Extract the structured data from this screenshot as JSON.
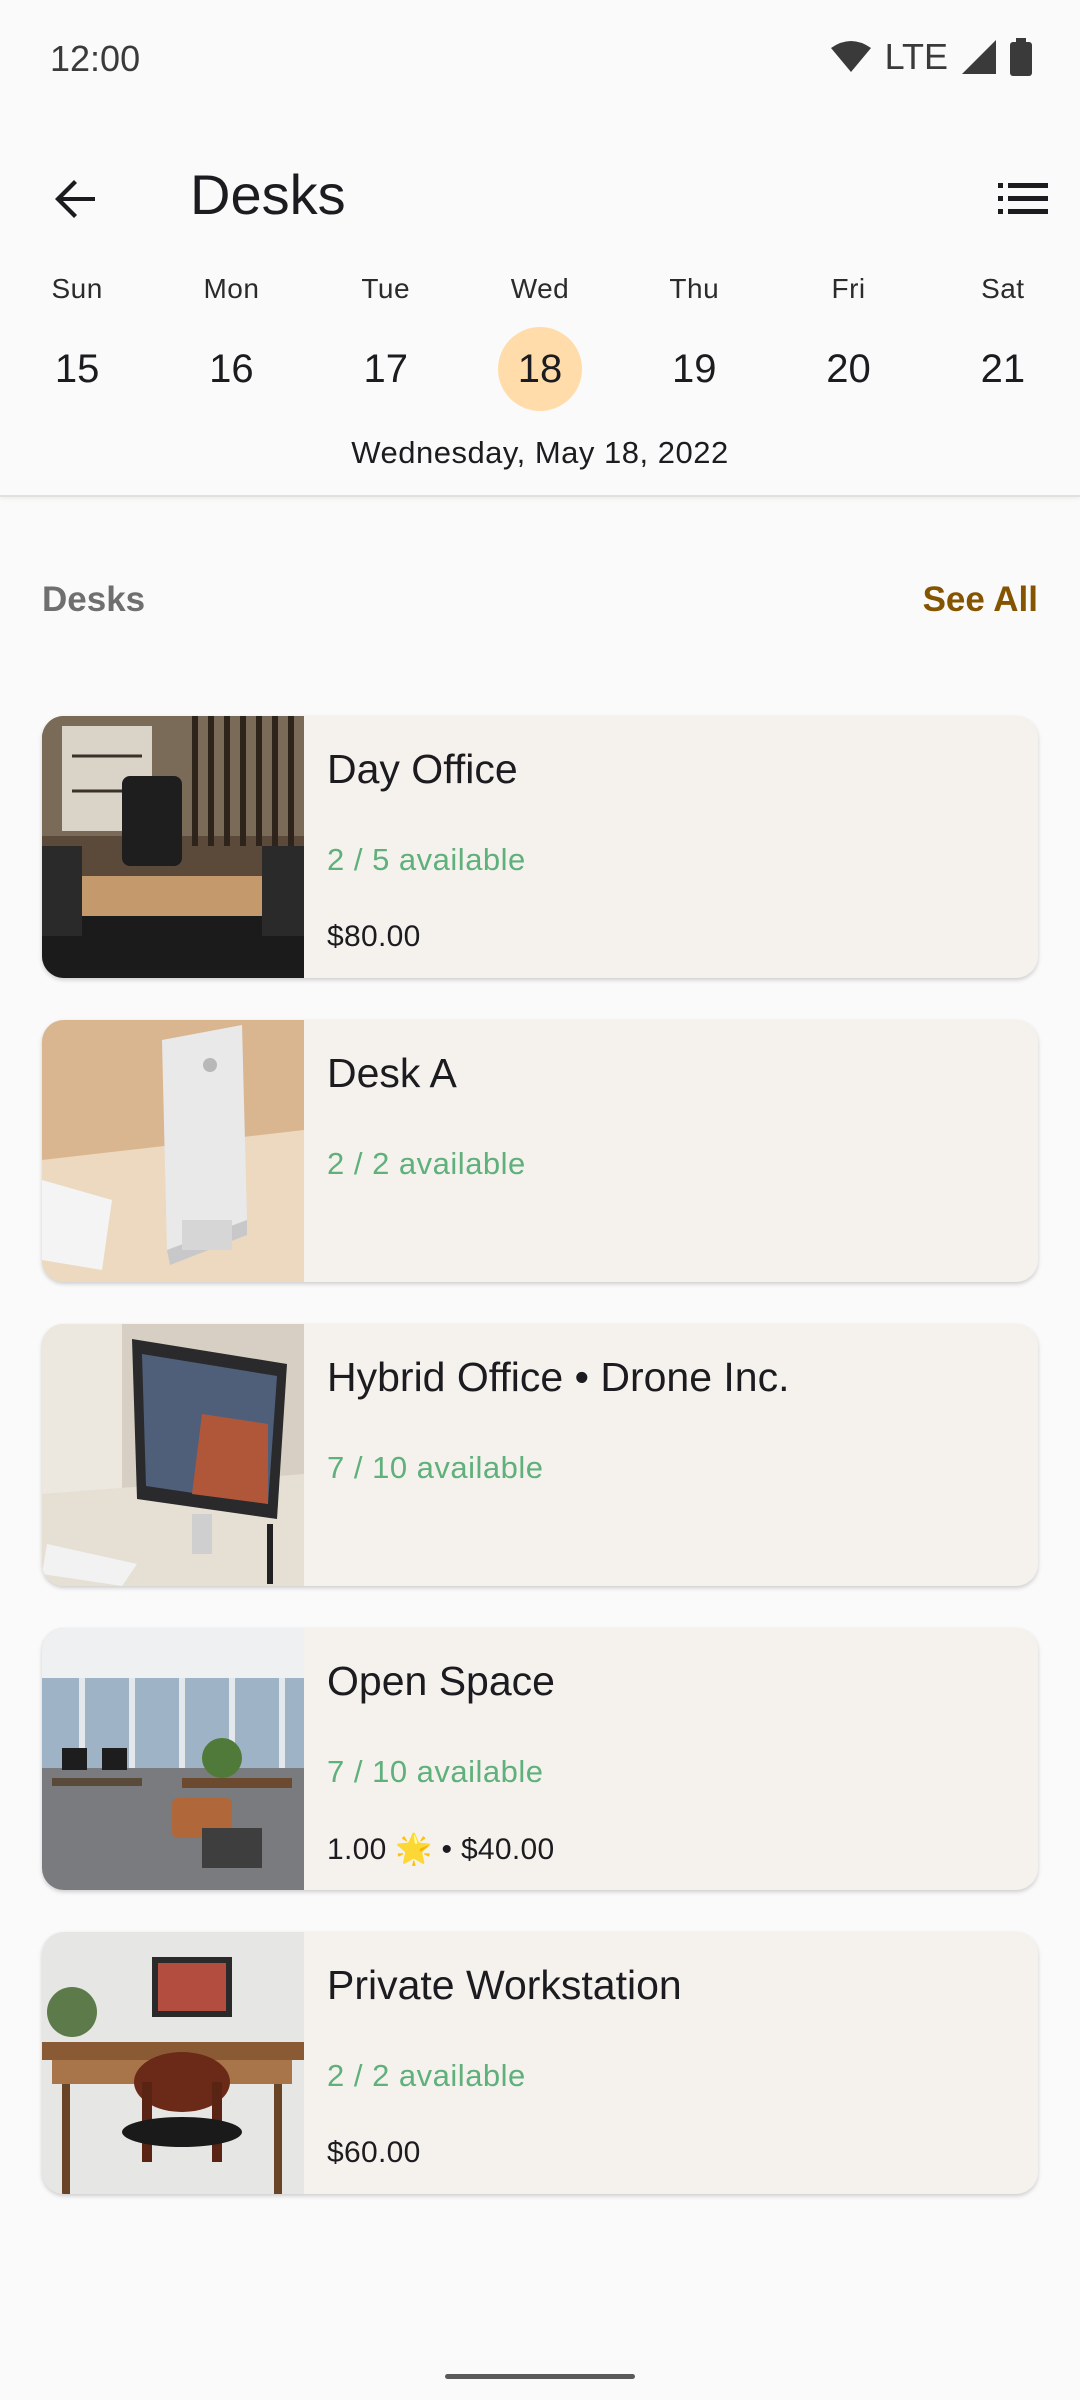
{
  "status_bar": {
    "time": "12:00",
    "network": "LTE"
  },
  "app_bar": {
    "title": "Desks"
  },
  "calendar": {
    "days": [
      {
        "name": "Sun",
        "num": "15"
      },
      {
        "name": "Mon",
        "num": "16"
      },
      {
        "name": "Tue",
        "num": "17"
      },
      {
        "name": "Wed",
        "num": "18"
      },
      {
        "name": "Thu",
        "num": "19"
      },
      {
        "name": "Fri",
        "num": "20"
      },
      {
        "name": "Sat",
        "num": "21"
      }
    ],
    "selected_index": 3,
    "full_date": "Wednesday, May 18, 2022",
    "selected_color": "#ffdcaa"
  },
  "section": {
    "title": "Desks",
    "see_all": "See All"
  },
  "desks": [
    {
      "title": "Day Office",
      "availability": "2 / 5 available",
      "price": "$80.00"
    },
    {
      "title": "Desk A",
      "availability": "2 / 2 available",
      "price": ""
    },
    {
      "title": "Hybrid Office • Drone Inc.",
      "availability": "7 / 10 available",
      "price": ""
    },
    {
      "title": "Open Space",
      "availability": "7 / 10 available",
      "price": "1.00 🌟 • $40.00"
    },
    {
      "title": "Private Workstation",
      "availability": "2 / 2 available",
      "price": "$60.00"
    }
  ],
  "colors": {
    "accent": "#855400",
    "available": "#5fb07a",
    "card_bg": "#f5f2ee"
  }
}
